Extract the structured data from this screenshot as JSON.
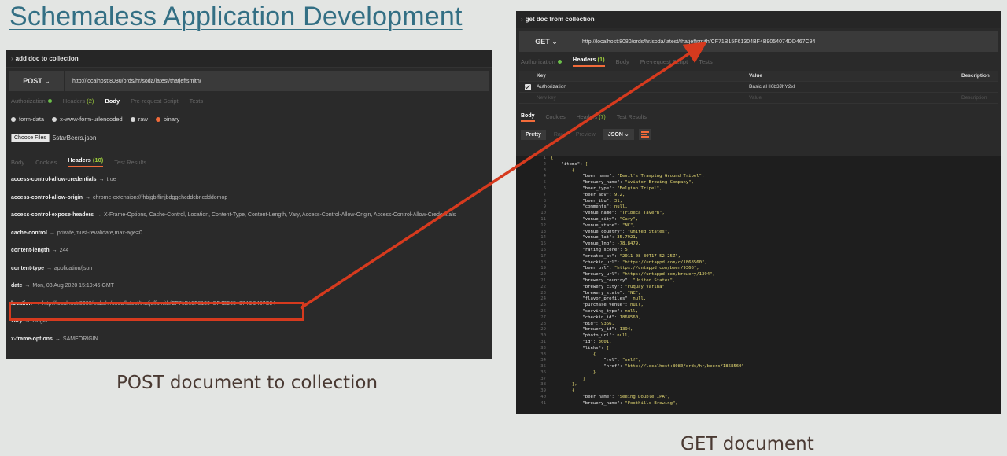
{
  "slide": {
    "title": "Schemaless Application Development",
    "caption_left": "POST document to collection",
    "caption_right": "GET document"
  },
  "left": {
    "header": "add doc to collection",
    "method": "POST",
    "url": "http://localhost:8080/ords/hr/soda/latest/thatjeffsmith/",
    "tabs": [
      "Authorization",
      "Headers (2)",
      "Body",
      "Pre-request Script",
      "Tests"
    ],
    "body_options": [
      "form-data",
      "x-www-form-urlencoded",
      "raw",
      "binary"
    ],
    "choose_files": "Choose Files",
    "file_name": "5starBeers.json",
    "resp_tabs": [
      "Body",
      "Cookies",
      "Headers (10)",
      "Test Results"
    ],
    "headers": [
      {
        "key": "access-control-allow-credentials",
        "value": "true"
      },
      {
        "key": "access-control-allow-origin",
        "value": "chrome-extension://fhbjgbiflinjbdggehcddcbncdddomop"
      },
      {
        "key": "access-control-expose-headers",
        "value": "X-Frame-Options, Cache-Control, Location, Content-Type, Content-Length, Vary, Access-Control-Allow-Origin, Access-Control-Allow-Credentials"
      },
      {
        "key": "cache-control",
        "value": "private,must-revalidate,max-age=0"
      },
      {
        "key": "content-length",
        "value": "244"
      },
      {
        "key": "content-type",
        "value": "application/json"
      },
      {
        "key": "date",
        "value": "Mon, 03 Aug 2020 15:19:46 GMT"
      },
      {
        "key": "location",
        "value": "http://localhost:8080/ords/hr/soda/latest/thatjeffsmith/CF71B15F61304BF4B9054074DD467C94"
      },
      {
        "key": "vary",
        "value": "Origin"
      },
      {
        "key": "x-frame-options",
        "value": "SAMEORIGIN"
      }
    ]
  },
  "right": {
    "header": "get doc from collection",
    "method": "GET",
    "url": "http://localhost:8080/ords/hr/soda/latest/thatjeffsmith/CF71B15F61304BF4B9054074DD467C94",
    "tabs": [
      "Authorization",
      "Headers (1)",
      "Body",
      "Pre-request Script",
      "Tests"
    ],
    "table_head": {
      "key": "Key",
      "value": "Value",
      "desc": "Description"
    },
    "table_row": {
      "key": "Authorization",
      "value": "Basic aHI6b3JhY2xl"
    },
    "table_placeholder": {
      "key": "New key",
      "value": "Value",
      "desc": "Description"
    },
    "resp_tabs": [
      "Body",
      "Cookies",
      "Headers (7)",
      "Test Results"
    ],
    "format_buttons": [
      "Pretty",
      "Raw",
      "Preview",
      "JSON"
    ],
    "code_lines": [
      "{",
      "    \"items\": [",
      "        {",
      "            \"beer_name\": \"Devil's Tramping Ground Tripel\",",
      "            \"brewery_name\": \"Aviator Brewing Company\",",
      "            \"beer_type\": \"Belgian Tripel\",",
      "            \"beer_abv\": 9.2,",
      "            \"beer_ibu\": 31,",
      "            \"comments\": null,",
      "            \"venue_name\": \"Tribeca Tavern\",",
      "            \"venue_city\": \"Cary\",",
      "            \"venue_state\": \"NC\",",
      "            \"venue_country\": \"United States\",",
      "            \"venue_lat\": 35.7921,",
      "            \"venue_lng\": -78.8479,",
      "            \"rating_score\": 5,",
      "            \"created_at\": \"2011-08-30T17:52:25Z\",",
      "            \"checkin_url\": \"https://untappd.com/c/1868560\",",
      "            \"beer_url\": \"https://untappd.com/beer/9366\",",
      "            \"brewery_url\": \"https://untappd.com/brewery/1394\",",
      "            \"brewery_country\": \"United States\",",
      "            \"brewery_city\": \"Fuquay Varina\",",
      "            \"brewery_state\": \"NC\",",
      "            \"flavor_profiles\": null,",
      "            \"purchase_venue\": null,",
      "            \"serving_type\": null,",
      "            \"checkin_id\": 1868560,",
      "            \"bid\": 9366,",
      "            \"brewery_id\": 1394,",
      "            \"photo_url\": null,",
      "            \"id\": 3001,",
      "            \"links\": [",
      "                {",
      "                    \"rel\": \"self\",",
      "                    \"href\": \"http://localhost:8080/ords/hr/beers/1868560\"",
      "                }",
      "            ]",
      "        },",
      "        {",
      "            \"beer_name\": \"Seeing Double IPA\",",
      "            \"brewery_name\": \"Foothills Brewing\","
    ]
  },
  "colors": {
    "accent": "#f26b3a",
    "highlight": "#d63a1e",
    "title": "#336f84"
  }
}
